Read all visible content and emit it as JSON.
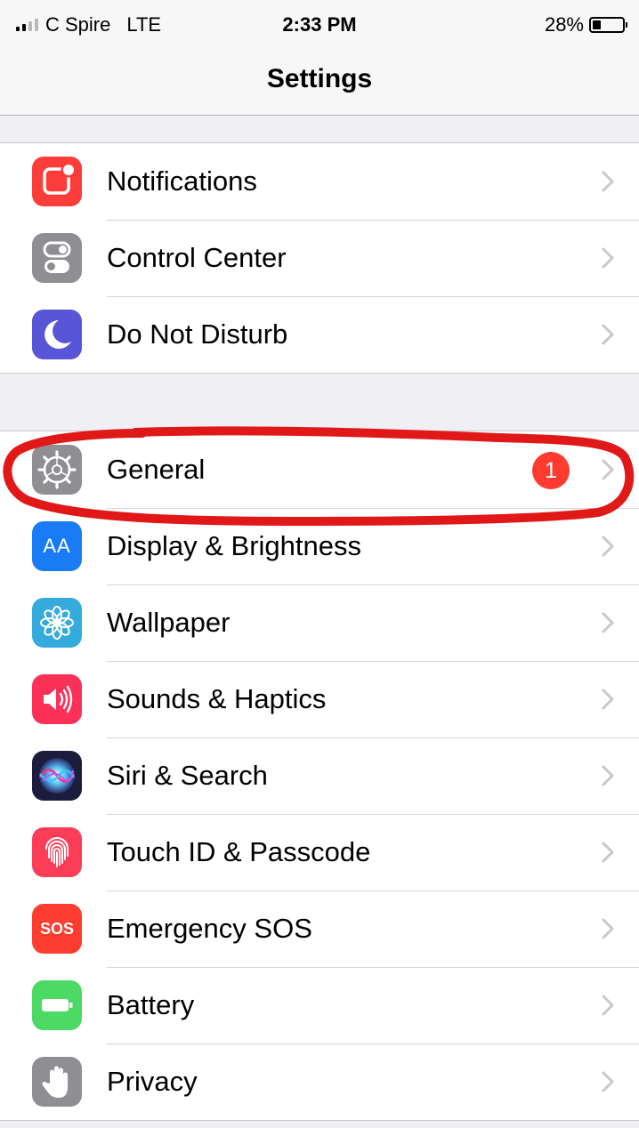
{
  "status_bar": {
    "carrier": "C Spire",
    "network": "LTE",
    "time": "2:33 PM",
    "battery_percent": "28%",
    "battery_level": 0.28
  },
  "nav": {
    "title": "Settings"
  },
  "groups": [
    {
      "items": [
        {
          "label": "Notifications",
          "icon": "notifications-icon",
          "color": "#fc3d39"
        },
        {
          "label": "Control Center",
          "icon": "control-center-icon",
          "color": "#8e8e93"
        },
        {
          "label": "Do Not Disturb",
          "icon": "moon-icon",
          "color": "#5856d6"
        }
      ]
    },
    {
      "items": [
        {
          "label": "General",
          "icon": "gear-icon",
          "color": "#8e8e93",
          "badge": "1"
        },
        {
          "label": "Display & Brightness",
          "icon": "display-icon",
          "color": "#1a7cf5",
          "icon_text": "AA"
        },
        {
          "label": "Wallpaper",
          "icon": "wallpaper-flower-icon",
          "color": "#35aadc"
        },
        {
          "label": "Sounds & Haptics",
          "icon": "speaker-icon",
          "color": "#fc3158"
        },
        {
          "label": "Siri & Search",
          "icon": "siri-icon",
          "color": "#1c1c3c"
        },
        {
          "label": "Touch ID & Passcode",
          "icon": "fingerprint-icon",
          "color": "#fc3d58"
        },
        {
          "label": "Emergency SOS",
          "icon": "sos-icon",
          "color": "#fc3d2f",
          "icon_text": "SOS"
        },
        {
          "label": "Battery",
          "icon": "battery-icon",
          "color": "#4cd964"
        },
        {
          "label": "Privacy",
          "icon": "hand-icon",
          "color": "#8e8e93"
        }
      ]
    }
  ],
  "colors": {
    "annotation_circle": "#e01818",
    "badge": "#ff3b30",
    "chevron": "#c7c7cc",
    "background": "#efeff4"
  }
}
